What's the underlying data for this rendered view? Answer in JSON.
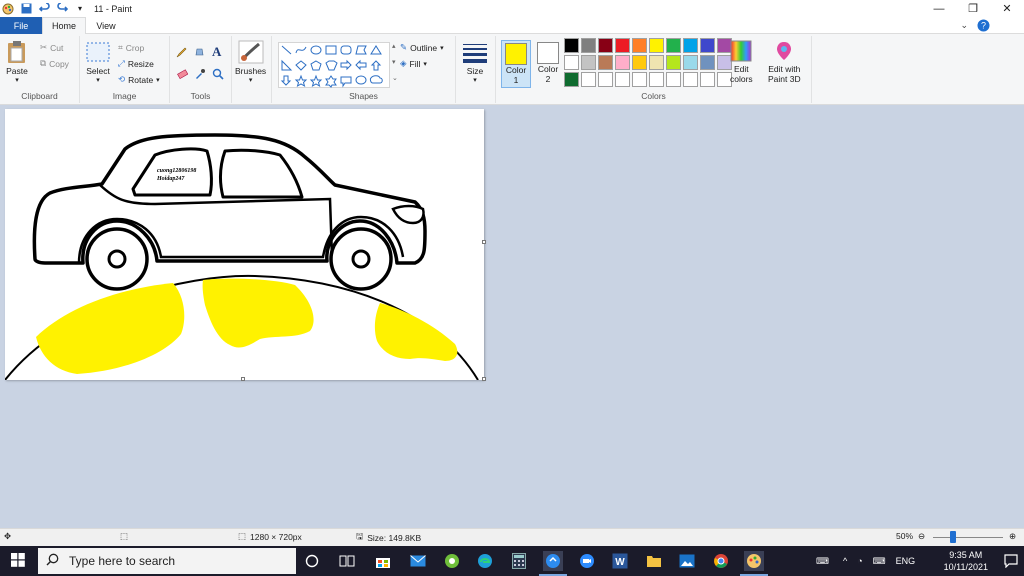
{
  "window": {
    "title": "11 - Paint",
    "controls": {
      "minimize": "—",
      "restore": "❐",
      "close": "✕"
    }
  },
  "tabs": [
    {
      "label": "File"
    },
    {
      "label": "Home"
    },
    {
      "label": "View"
    }
  ],
  "ribbon": {
    "clipboard": {
      "paste": "Paste",
      "cut": "Cut",
      "copy": "Copy",
      "group": "Clipboard"
    },
    "image": {
      "select": "Select",
      "crop": "Crop",
      "resize": "Resize",
      "rotate": "Rotate",
      "group": "Image"
    },
    "tools": {
      "group": "Tools"
    },
    "brushes": {
      "label": "Brushes"
    },
    "shapes": {
      "outline": "Outline",
      "fill": "Fill",
      "group": "Shapes"
    },
    "size": {
      "label": "Size"
    },
    "colors": {
      "color1_label": "Color",
      "color1_num": "1",
      "color1_value": "#fff200",
      "color2_label": "Color",
      "color2_num": "2",
      "color2_value": "#ffffff",
      "edit_label": "Edit",
      "edit_label2": "colors",
      "group": "Colors",
      "palette": [
        "#000000",
        "#7f7f7f",
        "#880015",
        "#ed1c24",
        "#ff7f27",
        "#fff200",
        "#22b14c",
        "#00a2e8",
        "#3f48cc",
        "#a349a4",
        "#ffffff",
        "#c3c3c3",
        "#b97a57",
        "#ffaec9",
        "#ffc90e",
        "#efe4b0",
        "#b5e61d",
        "#99d9ea",
        "#7092be",
        "#c8bfe7",
        "#0f6b2f",
        "#ffffff",
        "#ffffff",
        "#ffffff",
        "#ffffff",
        "#ffffff",
        "#ffffff",
        "#ffffff",
        "#ffffff",
        "#ffffff"
      ]
    },
    "paint3d": {
      "label": "Edit with",
      "label2": "Paint 3D"
    }
  },
  "canvas": {
    "watermark_line1": "cuong12806198",
    "watermark_line2": "Hoidap247",
    "fill_color": "#fff200"
  },
  "status": {
    "dimensions": "1280 × 720px",
    "size": "Size: 149.8KB",
    "zoom": "50%",
    "zoom_level": 0.5
  },
  "taskbar": {
    "search_placeholder": "Type here to search",
    "language": "ENG",
    "time": "9:35 AM",
    "date": "10/11/2021"
  }
}
